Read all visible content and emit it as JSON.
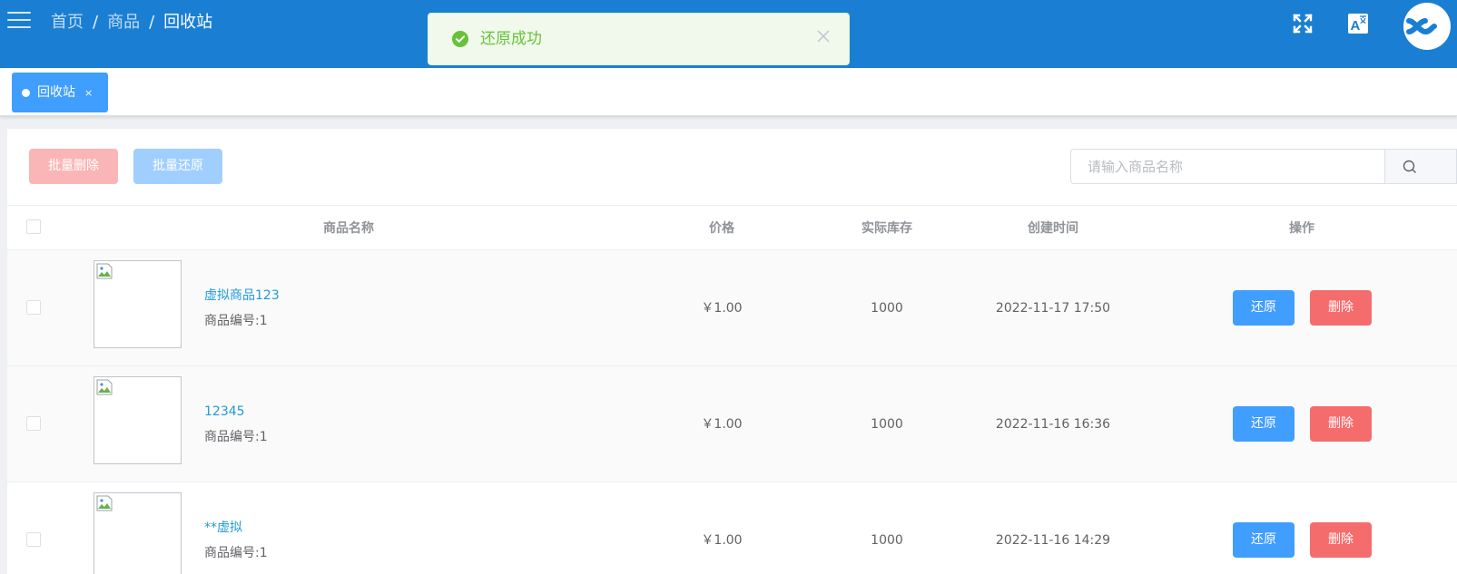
{
  "header": {
    "breadcrumb": [
      "首页",
      "商品",
      "回收站"
    ],
    "separator": "/",
    "icons": [
      "menu-icon",
      "fullscreen-icon",
      "translate-icon",
      "avatar"
    ],
    "colors": {
      "bar": "#1a7fd3"
    }
  },
  "toast": {
    "message": "还原成功",
    "type": "success",
    "color": "#67c23a"
  },
  "tags": [
    {
      "label": "回收站",
      "close": "×"
    }
  ],
  "toolbar": {
    "batch_delete_label": "批量删除",
    "batch_restore_label": "批量还原",
    "search_placeholder": "请输入商品名称"
  },
  "table": {
    "columns": [
      "商品名称",
      "价格",
      "实际库存",
      "创建时间",
      "操作"
    ],
    "rows": [
      {
        "name": "虚拟商品123",
        "code": "商品编号:1",
        "price": "￥1.00",
        "stock": "1000",
        "created": "2022-11-17 17:50",
        "restore": "还原",
        "delete": "删除"
      },
      {
        "name": "12345",
        "code": "商品编号:1",
        "price": "￥1.00",
        "stock": "1000",
        "created": "2022-11-16 16:36",
        "restore": "还原",
        "delete": "删除"
      },
      {
        "name": "**虚拟",
        "code": "商品编号:1",
        "price": "￥1.00",
        "stock": "1000",
        "created": "2022-11-16 14:29",
        "restore": "还原",
        "delete": "删除"
      }
    ]
  }
}
